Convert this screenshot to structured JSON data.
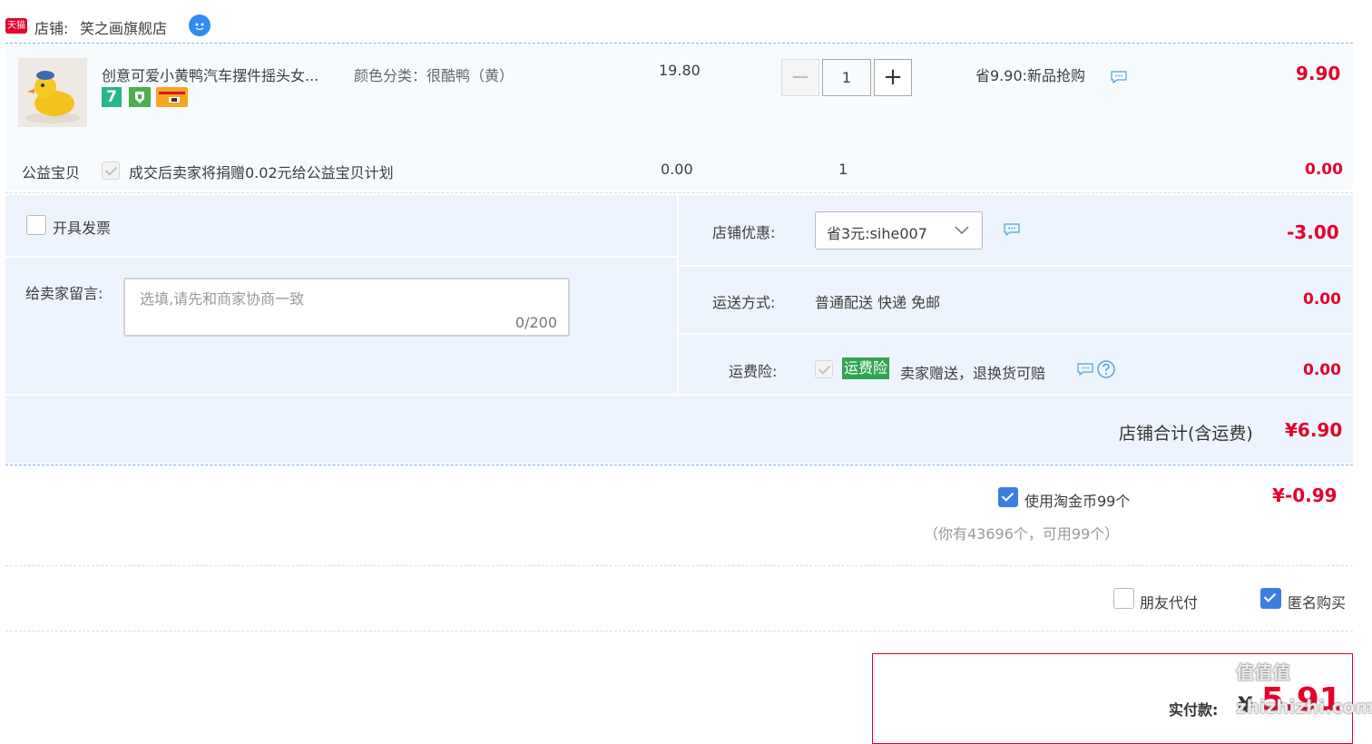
{
  "shop": {
    "platform_badge": "天猫",
    "label": "店铺: ",
    "name": "笑之画旗舰店"
  },
  "item": {
    "title": "创意可爱小黄鸭汽车摆件摇头女...",
    "sku": "颜色分类：很酷鸭（黄）",
    "badge_7": "7",
    "unit_price": "19.80",
    "quantity": "1",
    "minus_label": "−",
    "plus_label": "+",
    "promo": "省9.90:新品抢购",
    "subtotal": "9.90"
  },
  "charity": {
    "label": "公益宝贝",
    "text": "成交后卖家将捐赠0.02元给公益宝贝计划",
    "price": "0.00",
    "quantity": "1",
    "subtotal": "0.00"
  },
  "invoice": {
    "label": "开具发票"
  },
  "message": {
    "label": "给卖家留言:",
    "placeholder": "选填,请先和商家协商一致",
    "counter": "0/200"
  },
  "shop_discount": {
    "label": "店铺优惠:",
    "selected": "省3元:sihe007",
    "amount": "-3.00"
  },
  "shipping": {
    "label": "运送方式:",
    "value": "普通配送 快递 免邮",
    "amount": "0.00"
  },
  "insurance": {
    "label": "运费险:",
    "badge": "运费险",
    "text": "卖家赠送，退换货可赔",
    "amount": "0.00"
  },
  "shop_total": {
    "label": "店铺合计(含运费)",
    "amount": "¥6.90"
  },
  "coins": {
    "label": "使用淘金币99个",
    "amount": "¥-0.99",
    "note": "（你有43696个，可用99个）"
  },
  "options": {
    "friend_pay": "朋友代付",
    "anonymous": "匿名购买"
  },
  "payment": {
    "label": "实付款:",
    "currency": "¥",
    "amount": "5.91"
  },
  "watermark": "值值值 zhizhizhi.com",
  "colors": {
    "accent_red": "#e4002b",
    "blue_check": "#3d7fe0",
    "panel_bg": "#eef4fd",
    "insurance_green": "#2fa44f"
  }
}
